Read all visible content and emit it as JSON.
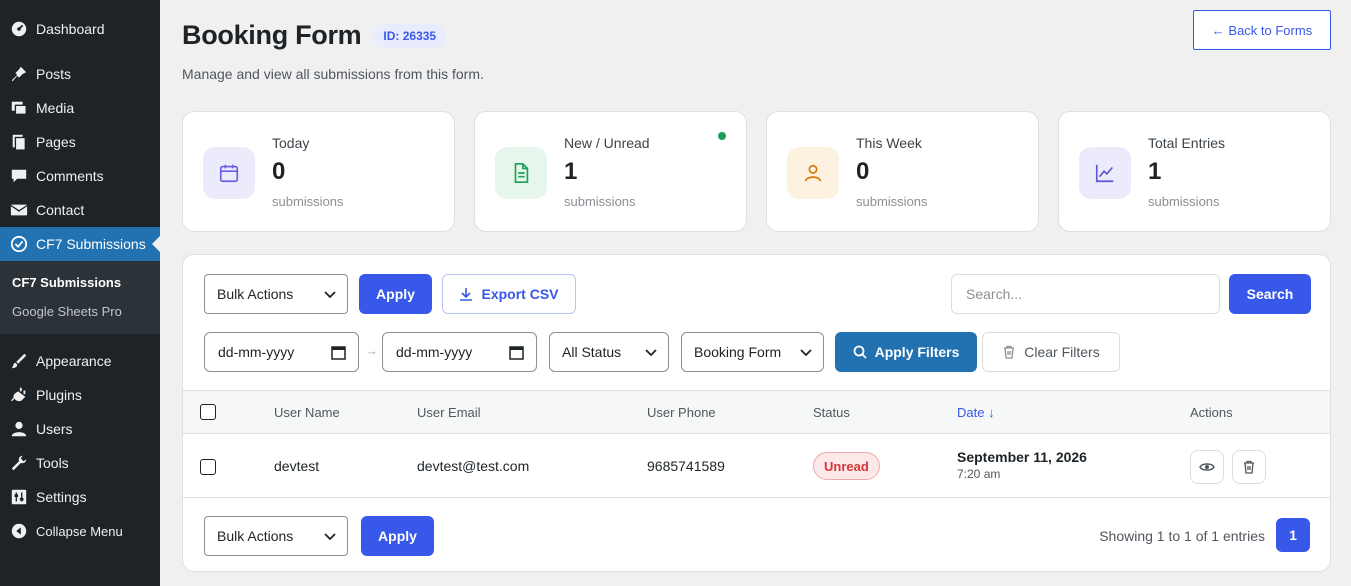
{
  "sidebar": {
    "items": [
      {
        "label": "Dashboard",
        "icon": "dashboard-icon"
      },
      {
        "label": "Posts",
        "icon": "pin-icon"
      },
      {
        "label": "Media",
        "icon": "media-icon"
      },
      {
        "label": "Pages",
        "icon": "pages-icon"
      },
      {
        "label": "Comments",
        "icon": "comment-icon"
      },
      {
        "label": "Contact",
        "icon": "mail-icon"
      },
      {
        "label": "CF7 Submissions",
        "icon": "submissions-icon"
      }
    ],
    "submenu": [
      "CF7 Submissions",
      "Google Sheets Pro"
    ],
    "items_bottom": [
      {
        "label": "Appearance",
        "icon": "brush-icon"
      },
      {
        "label": "Plugins",
        "icon": "plug-icon"
      },
      {
        "label": "Users",
        "icon": "user-icon"
      },
      {
        "label": "Tools",
        "icon": "wrench-icon"
      },
      {
        "label": "Settings",
        "icon": "settings-icon"
      },
      {
        "label": "Collapse Menu",
        "icon": "collapse-icon"
      }
    ]
  },
  "header": {
    "title": "Booking Form",
    "id_badge": "ID: 26335",
    "subtitle": "Manage and view all submissions from this form.",
    "back_button": "← Back to Forms"
  },
  "stats": [
    {
      "label": "Today",
      "value": "0",
      "unit": "submissions",
      "icon": "calendar-icon",
      "color": "#6b5ce7",
      "bg": "#ecebfc"
    },
    {
      "label": "New / Unread",
      "value": "1",
      "unit": "submissions",
      "icon": "document-icon",
      "color": "#1e9e55",
      "bg": "#e6f6ec"
    },
    {
      "label": "This Week",
      "value": "0",
      "unit": "submissions",
      "icon": "user-icon",
      "color": "#d97706",
      "bg": "#fdf1e0"
    },
    {
      "label": "Total Entries",
      "value": "1",
      "unit": "submissions",
      "icon": "chart-icon",
      "color": "#5b57d6",
      "bg": "#ecebfc"
    }
  ],
  "toolbar": {
    "bulk_actions": "Bulk Actions",
    "apply": "Apply",
    "export_csv": "Export CSV",
    "search_placeholder": "Search...",
    "search_button": "Search"
  },
  "filters": {
    "date_from": "dd-mm-yyyy",
    "date_to": "dd-mm-yyyy",
    "status": "All Status",
    "form": "Booking Form",
    "apply_filters": "Apply Filters",
    "clear_filters": "Clear Filters"
  },
  "table": {
    "columns": [
      "User Name",
      "User Email",
      "User Phone",
      "Status",
      "Date ↓",
      "Actions"
    ],
    "rows": [
      {
        "name": "devtest",
        "email": "devtest@test.com",
        "phone": "9685741589",
        "status": "Unread",
        "date": "September 11, 2026",
        "time": "7:20 am"
      }
    ]
  },
  "footer": {
    "bulk_actions": "Bulk Actions",
    "apply": "Apply",
    "showing": "Showing 1 to 1 of 1 entries",
    "page": "1"
  },
  "colors": {
    "accent": "#3858e9",
    "sidebar_bg": "#1d2327",
    "filter_button": "#2271b1",
    "unread": "#d63638",
    "online_dot": "#1e9e55"
  }
}
